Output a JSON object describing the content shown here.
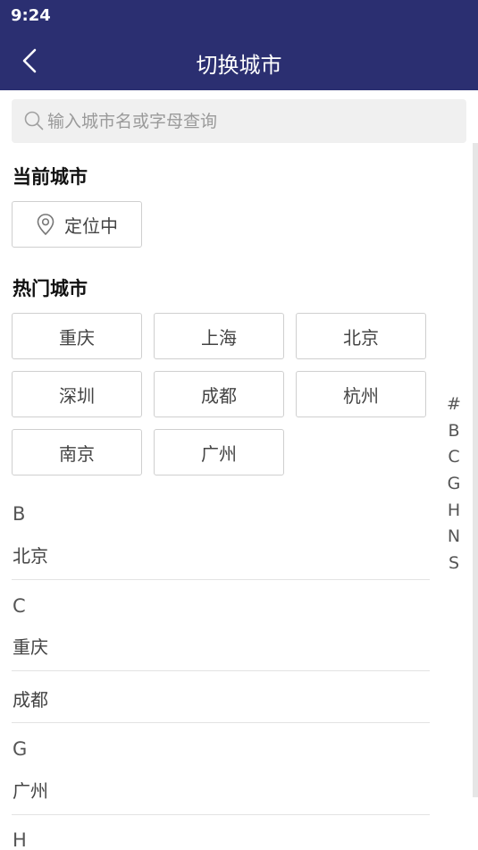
{
  "status_bar": {
    "time": "9:24"
  },
  "nav": {
    "title": "切换城市"
  },
  "search": {
    "placeholder": "输入城市名或字母查询"
  },
  "current_city": {
    "heading": "当前城市",
    "locating_label": "定位中"
  },
  "hot_cities": {
    "heading": "热门城市",
    "items": [
      "重庆",
      "上海",
      "北京",
      "深圳",
      "成都",
      "杭州",
      "南京",
      "广州"
    ]
  },
  "index_letters": [
    "#",
    "B",
    "C",
    "G",
    "H",
    "N",
    "S"
  ],
  "city_list": [
    {
      "letter": "B",
      "cities": [
        "北京"
      ]
    },
    {
      "letter": "C",
      "cities": [
        "重庆",
        "成都"
      ]
    },
    {
      "letter": "G",
      "cities": [
        "广州"
      ]
    },
    {
      "letter": "H",
      "cities": []
    }
  ],
  "colors": {
    "header_bg": "#2b2f71",
    "search_bg": "#f0f0f0",
    "border": "#cfcfcf"
  }
}
